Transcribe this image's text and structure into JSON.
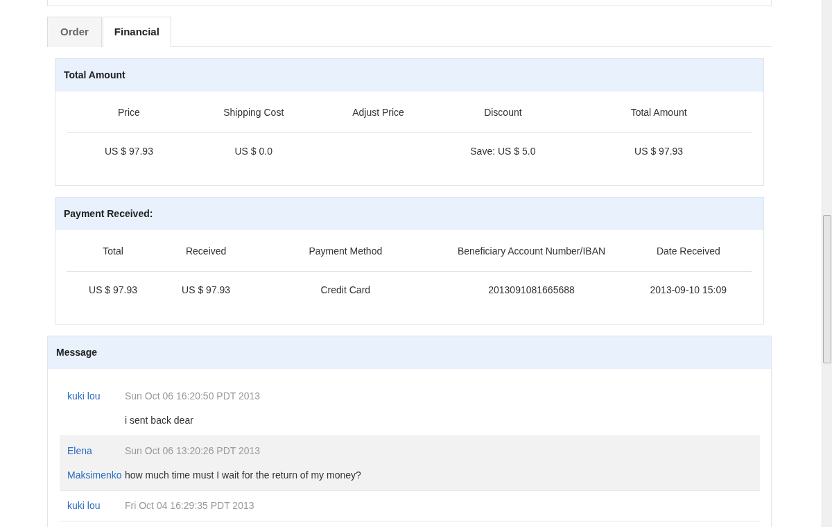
{
  "tabs": [
    {
      "label": "Order",
      "selected": false
    },
    {
      "label": "Financial",
      "selected": true
    }
  ],
  "sections": [
    {
      "title": "Total Amount",
      "columns": [
        {
          "header": "Price",
          "value": "US $ 97.93"
        },
        {
          "header": "Shipping Cost",
          "value": "US $ 0.0"
        },
        {
          "header": "Adjust Price"
        },
        {
          "header": "Discount",
          "value": "Save: US $ 5.0"
        },
        {
          "header": "Total Amount",
          "value": "US $ 97.93"
        }
      ]
    },
    {
      "title": "Payment Received:",
      "columns": [
        {
          "header": "Total",
          "value": "US $ 97.93"
        },
        {
          "header": "Received",
          "value": "US $ 97.93"
        },
        {
          "header": "Payment Method",
          "value": "Credit Card"
        },
        {
          "header": "Beneficiary Account Number/IBAN",
          "value": "2013091081665688"
        },
        {
          "header": "Date Received",
          "value": "2013-09-10 15:09"
        }
      ]
    }
  ],
  "message_panel": {
    "title": "Message",
    "messages": [
      {
        "author": "kuki lou",
        "time": "Sun Oct 06 16:20:50 PDT 2013",
        "text": "i sent back dear",
        "highlighted": false
      },
      {
        "author": "Elena Maksimenko",
        "time": "Sun Oct 06 13:20:26 PDT 2013",
        "text": "how much time must I wait for the return of my money?",
        "highlighted": true
      },
      {
        "author": "kuki lou",
        "time": "Fri Oct 04 16:29:35 PDT 2013",
        "highlighted": false
      }
    ]
  }
}
